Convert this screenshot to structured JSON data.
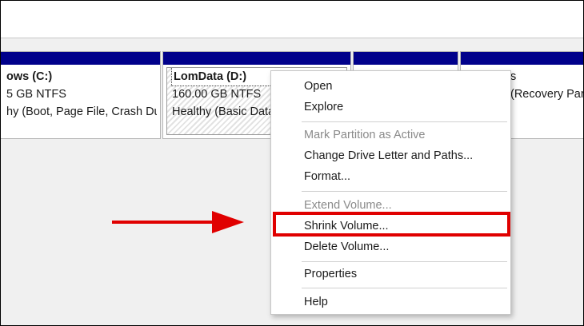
{
  "partitions": [
    {
      "lines": [
        "ows  (C:)",
        "5 GB NTFS",
        "hy (Boot, Page File, Crash Dump"
      ]
    },
    {
      "lines": [
        "LomData  (D:)",
        "160.00 GB NTFS",
        "Healthy (Basic Data Partition)"
      ]
    },
    {
      "lines": [
        "",
        "",
        ""
      ]
    },
    {
      "lines": [
        "",
        "s",
        "(Recovery Parti"
      ]
    }
  ],
  "context_menu": {
    "items": [
      {
        "label": "Open",
        "disabled": false
      },
      {
        "label": "Explore",
        "disabled": false
      },
      {
        "label": "Mark Partition as Active",
        "disabled": true
      },
      {
        "label": "Change Drive Letter and Paths...",
        "disabled": false
      },
      {
        "label": "Format...",
        "disabled": false
      },
      {
        "label": "Extend Volume...",
        "disabled": true
      },
      {
        "label": "Shrink Volume...",
        "disabled": false,
        "highlighted": true
      },
      {
        "label": "Delete Volume...",
        "disabled": false
      },
      {
        "label": "Properties",
        "disabled": false
      },
      {
        "label": "Help",
        "disabled": false
      }
    ]
  },
  "colors": {
    "partition_header": "#00008b",
    "annotation": "#e00000"
  },
  "annotation": {
    "icon": "arrow-right-icon"
  }
}
